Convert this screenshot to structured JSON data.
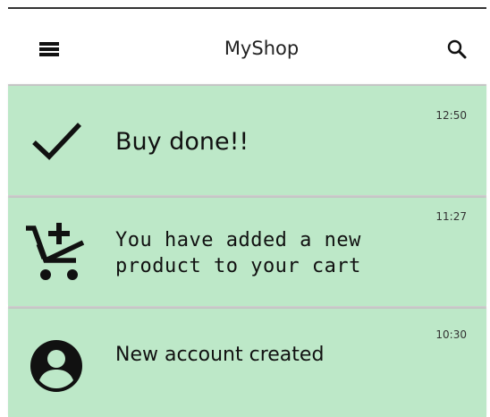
{
  "app_bar": {
    "title": "MyShop",
    "menu_icon": "menu-icon",
    "search_icon": "search-icon"
  },
  "colors": {
    "card_background": "#bde8c8",
    "app_bar_background": "#ffffff",
    "text": "#111111"
  },
  "notifications": [
    {
      "icon": "check-icon",
      "text": "Buy done!!",
      "time": "12:50"
    },
    {
      "icon": "add-shopping-cart-icon",
      "text_line_1": "You have added a new",
      "text_line_2": "product to your cart",
      "time": "11:27"
    },
    {
      "icon": "account-circle-icon",
      "text": "New account created",
      "time": "10:30"
    }
  ]
}
